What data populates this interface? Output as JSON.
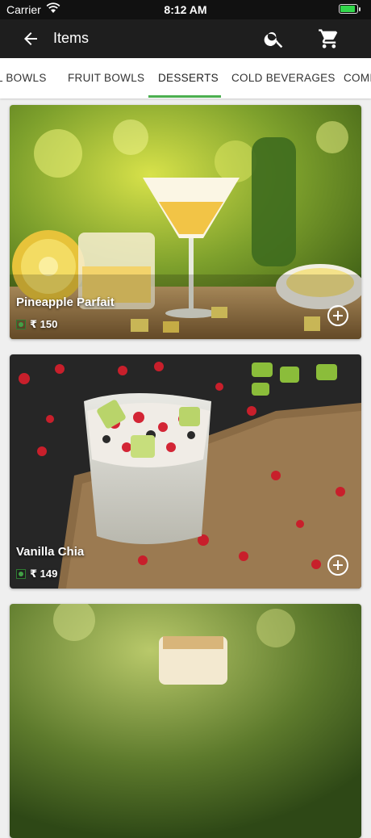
{
  "status_bar": {
    "carrier": "Carrier",
    "time": "8:12 AM"
  },
  "header": {
    "title": "Items",
    "back_icon": "arrow-back-icon",
    "search_icon": "search-icon",
    "cart_icon": "cart-icon"
  },
  "tabs": [
    {
      "label": "L BOWLS"
    },
    {
      "label": "FRUIT BOWLS"
    },
    {
      "label": "DESSERTS",
      "active": true
    },
    {
      "label": "COLD BEVERAGES"
    },
    {
      "label": "COMI"
    }
  ],
  "items": [
    {
      "name": "Pineapple Parfait",
      "price": "₹ 150"
    },
    {
      "name": "Vanilla Chia",
      "price": "₹ 149"
    }
  ],
  "colors": {
    "accent": "#4caf50",
    "app_bar": "#1e1e1e",
    "veg": "#43a047"
  }
}
